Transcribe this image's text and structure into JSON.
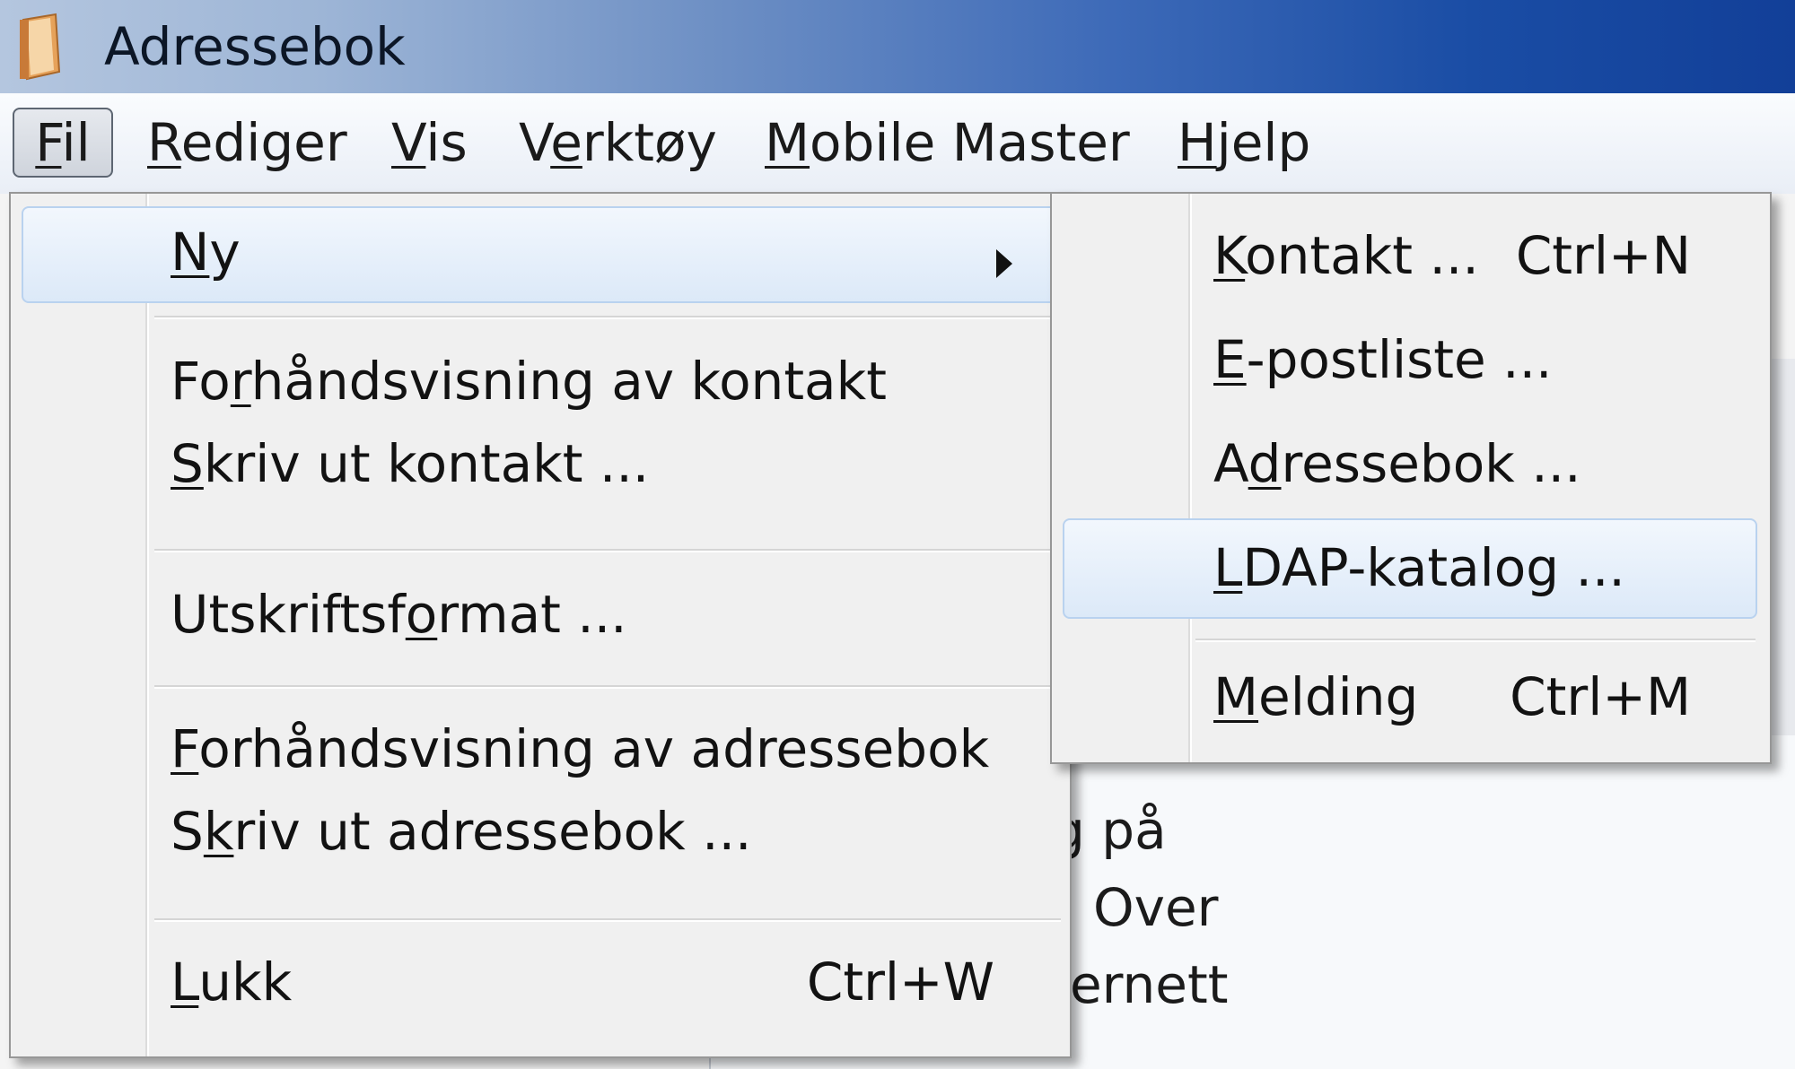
{
  "window": {
    "title": "Adressebok"
  },
  "menubar": {
    "items": [
      {
        "label": "Fil",
        "mnemonic": "F",
        "rest": "il"
      },
      {
        "label": "Rediger",
        "mnemonic": "R",
        "rest": "ediger"
      },
      {
        "label": "Vis",
        "mnemonic": "V",
        "rest": "is"
      },
      {
        "label": "Verktøy",
        "pre": "V",
        "mnemonic": "e",
        "rest": "rktøy"
      },
      {
        "label": "Mobile Master",
        "mnemonic": "M",
        "rest": "obile Master"
      },
      {
        "label": "Hjelp",
        "mnemonic": "H",
        "rest": "jelp"
      }
    ]
  },
  "file_menu": {
    "ny": {
      "pre": "",
      "mnemonic": "N",
      "rest": "y"
    },
    "preview_contact": {
      "pre": "Fo",
      "mnemonic": "r",
      "rest": "håndsvisning av kontakt"
    },
    "print_contact": {
      "pre": "",
      "mnemonic": "S",
      "rest": "kriv ut kontakt ..."
    },
    "print_format": {
      "pre": "Utskriftsf",
      "mnemonic": "o",
      "rest": "rmat ..."
    },
    "preview_book": {
      "pre": "",
      "mnemonic": "F",
      "rest": "orhåndsvisning av adressebok"
    },
    "print_book": {
      "pre": "S",
      "mnemonic": "k",
      "rest": "riv ut adressebok ..."
    },
    "close": {
      "pre": "",
      "mnemonic": "L",
      "rest": "ukk",
      "shortcut": "Ctrl+W"
    }
  },
  "sub_menu": {
    "contact": {
      "mnemonic": "K",
      "rest": "ontakt ...",
      "shortcut": "Ctrl+N"
    },
    "mailing_list": {
      "mnemonic": "E",
      "rest": "-postliste ..."
    },
    "address_book": {
      "pre": "A",
      "mnemonic": "d",
      "rest": "ressebok ..."
    },
    "ldap": {
      "mnemonic": "L",
      "rest": "DAP-katalog ..."
    },
    "message": {
      "mnemonic": "M",
      "rest": "elding",
      "shortcut": "Ctrl+M"
    }
  },
  "background": {
    "fragments": [
      "g på",
      "Over",
      "ernett"
    ]
  },
  "colors": {
    "highlight_border": "#b9d2ef",
    "title_bar_end": "#123f98"
  }
}
